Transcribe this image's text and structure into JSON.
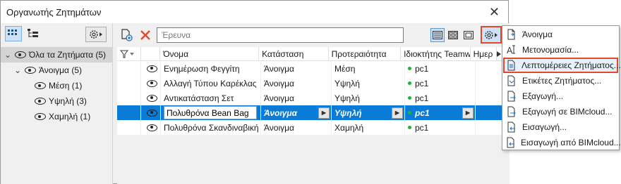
{
  "window": {
    "title": "Οργανωτής Ζητημάτων",
    "close_glyph": "✕"
  },
  "left": {
    "tree": [
      {
        "label": "Όλα τα Ζητήματα (5)",
        "level": 0,
        "expanded": true,
        "selected": true
      },
      {
        "label": "Άνοιγμα (5)",
        "level": 1,
        "expanded": true,
        "selected": false
      },
      {
        "label": "Μέση (1)",
        "level": 2,
        "selected": false
      },
      {
        "label": "Υψηλή (3)",
        "level": 2,
        "selected": false
      },
      {
        "label": "Χαμηλή (1)",
        "level": 2,
        "selected": false
      }
    ]
  },
  "search": {
    "placeholder": "Έρευνα"
  },
  "table": {
    "headers": [
      "Όνομα",
      "Κατάσταση",
      "Προτεραιότητα",
      "Ιδιοκτήτης Teamwork",
      "Ημερ"
    ],
    "rows": [
      {
        "name": "Ενημέρωση Φεγγίτη",
        "status": "Άνοιγμα",
        "priority": "Μέση",
        "owner": "pc1",
        "selected": false
      },
      {
        "name": "Αλλαγή Τύπου Καρέκλας",
        "status": "Άνοιγμα",
        "priority": "Υψηλή",
        "owner": "pc1",
        "selected": false
      },
      {
        "name": "Αντικατάσταση Σετ",
        "status": "Άνοιγμα",
        "priority": "Υψηλή",
        "owner": "pc1",
        "selected": false
      },
      {
        "name": "Πολυθρόνα Bean Bag",
        "status": "Άνοιγμα",
        "priority": "Υψηλή",
        "owner": "pc1",
        "selected": true
      },
      {
        "name": "Πολυθρόνα Σκανδιναβική",
        "status": "Άνοιγμα",
        "priority": "Χαμηλή",
        "owner": "pc1",
        "selected": false
      }
    ]
  },
  "menu": {
    "items": [
      {
        "label": "Άνοιγμα",
        "icon": "open-icon",
        "highlight": false
      },
      {
        "label": "Μετονομασία...",
        "icon": "rename-icon",
        "highlight": false
      },
      {
        "label": "Λεπτομέρειες Ζητήματος...",
        "icon": "details-icon",
        "highlight": true
      },
      {
        "label": "Ετικέτες Ζητήματος...",
        "icon": "tags-icon",
        "highlight": false
      },
      {
        "label": "Εξαγωγή...",
        "icon": "export-icon",
        "highlight": false
      },
      {
        "label": "Εξαγωγή σε BIMcloud...",
        "icon": "export-cloud-icon",
        "highlight": false
      },
      {
        "label": "Εισαγωγή...",
        "icon": "import-icon",
        "highlight": false
      },
      {
        "label": "Εισαγωγή από BIMcloud...",
        "icon": "import-cloud-icon",
        "highlight": false
      }
    ]
  },
  "colors": {
    "accent": "#0a7bd7",
    "highlight_border": "#e04a2b",
    "owner_dot": "#1db33a"
  }
}
